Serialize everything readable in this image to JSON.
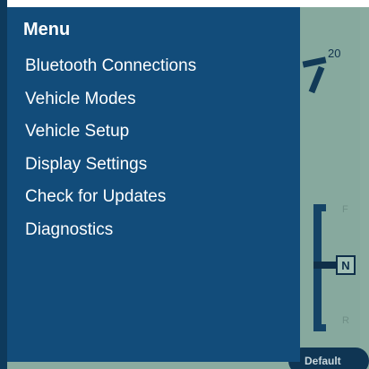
{
  "drawer": {
    "title": "Menu",
    "items": [
      {
        "label": "Bluetooth Connections"
      },
      {
        "label": "Vehicle Modes"
      },
      {
        "label": "Vehicle Setup"
      },
      {
        "label": "Display Settings"
      },
      {
        "label": "Check for Updates"
      },
      {
        "label": "Diagnostics"
      }
    ]
  },
  "dashboard": {
    "gauge_label": "20",
    "gear_top": "F",
    "gear_selected": "N",
    "gear_bottom": "R",
    "mode_button": "Default"
  },
  "colors": {
    "drawer_background": "#124c7a",
    "dashboard_background": "#87a99e",
    "text": "#ffffff"
  }
}
